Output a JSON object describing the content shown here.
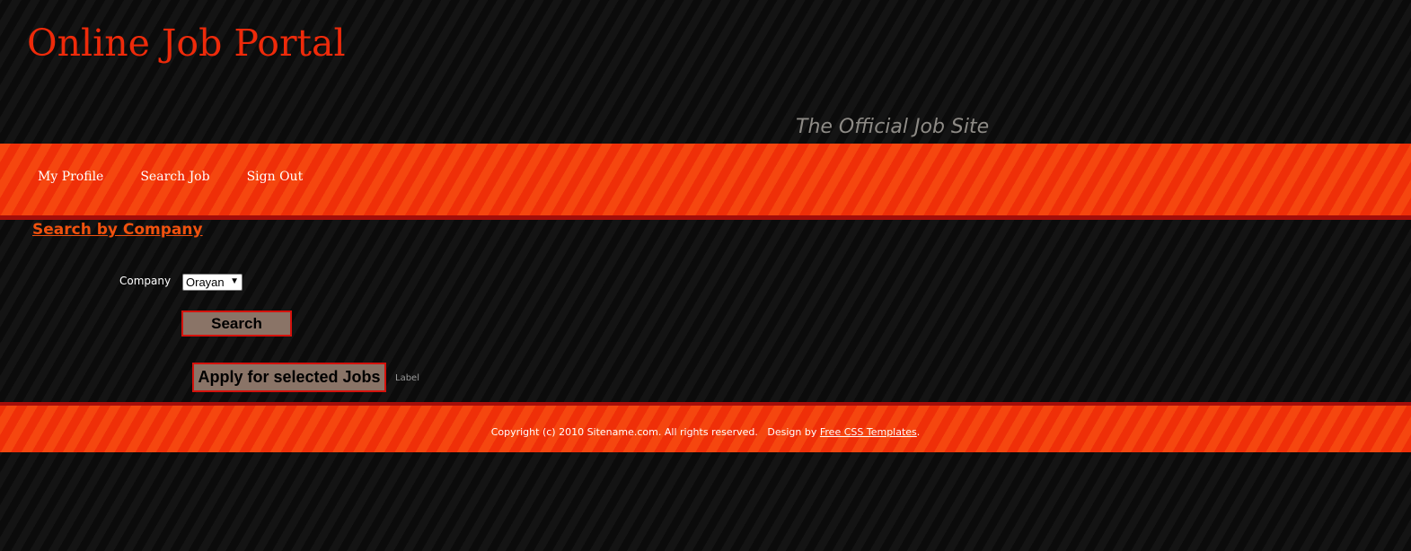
{
  "header": {
    "title": "Online Job Portal",
    "tagline": "The Official Job Site"
  },
  "menu": {
    "items": [
      {
        "label": "My Profile"
      },
      {
        "label": "Search Job"
      },
      {
        "label": "Sign Out"
      }
    ]
  },
  "main": {
    "heading": "Search by Company",
    "company_label": "Company",
    "company_selected": "Orayan",
    "search_button": "Search",
    "apply_button": "Apply for selected Jobs",
    "status_label": "Label"
  },
  "footer": {
    "copyright": "Copyright (c) 2010 Sitename.com. All rights reserved.",
    "design_by": "Design by",
    "link_text": "Free CSS Templates",
    "end": "."
  },
  "colors": {
    "title": "#ee2a0a",
    "accent_orange": "#f0380c",
    "dark_red_border": "#a50e0a",
    "button_fill": "#8a7467",
    "button_border": "#d4120c"
  },
  "icons": {
    "select_arrow": "chevron-down-icon"
  }
}
